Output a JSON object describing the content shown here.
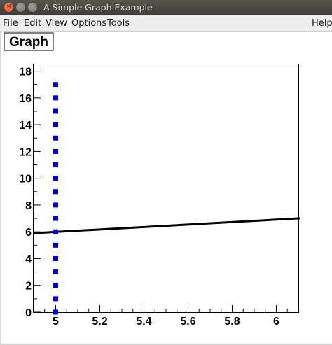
{
  "window": {
    "title": "A Simple Graph Example"
  },
  "menu": {
    "file": "File",
    "edit": "Edit",
    "view": "View",
    "options": "Options",
    "tools": "Tools",
    "help": "Help"
  },
  "colors": {
    "marker": "#0000cc",
    "line": "#000000",
    "frame": "#000000"
  },
  "chart_data": {
    "type": "scatter",
    "title": "Graph",
    "xlim": [
      4.9,
      6.1
    ],
    "ylim": [
      0,
      18.5
    ],
    "x_ticks": [
      5,
      5.2,
      5.4,
      5.6,
      5.8,
      6
    ],
    "x_tick_labels": [
      "5",
      "5.2",
      "5.4",
      "5.6",
      "5.8",
      "6"
    ],
    "y_ticks": [
      0,
      2,
      4,
      6,
      8,
      10,
      12,
      14,
      16,
      18
    ],
    "y_tick_labels": [
      "0",
      "2",
      "4",
      "6",
      "8",
      "10",
      "12",
      "14",
      "16",
      "18"
    ],
    "grid": false,
    "series": [
      {
        "type": "scatter",
        "x": [
          5,
          5,
          5,
          5,
          5,
          5,
          5,
          5,
          5,
          5,
          5,
          5,
          5,
          5,
          5,
          5,
          5,
          5
        ],
        "y": [
          0,
          1,
          2,
          3,
          4,
          5,
          6,
          7,
          8,
          9,
          10,
          11,
          12,
          13,
          14,
          15,
          16,
          17
        ]
      },
      {
        "type": "line",
        "x": [
          4.9,
          6.1
        ],
        "y": [
          5.9,
          7.0
        ]
      }
    ]
  }
}
